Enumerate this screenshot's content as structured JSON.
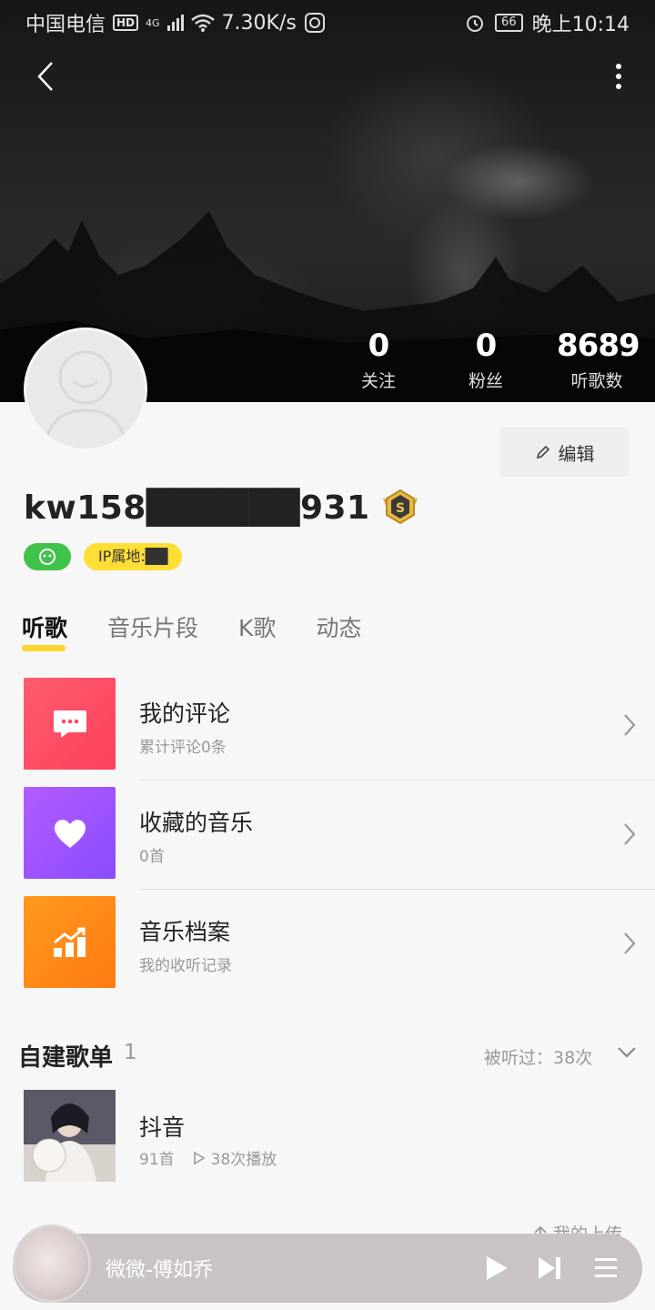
{
  "status_bar": {
    "carrier": "中国电信",
    "hd": "HD",
    "network": "4G",
    "speed": "7.30K/s",
    "battery": "66",
    "time": "晚上10:14"
  },
  "profile": {
    "stats": [
      {
        "value": "0",
        "label": "关注"
      },
      {
        "value": "0",
        "label": "粉丝"
      },
      {
        "value": "8689",
        "label": "听歌数"
      }
    ],
    "edit_label": "编辑",
    "username": "kw158██████931",
    "ip_label": "IP属地:██"
  },
  "tabs": [
    {
      "label": "听歌",
      "active": true
    },
    {
      "label": "音乐片段",
      "active": false
    },
    {
      "label": "K歌",
      "active": false
    },
    {
      "label": "动态",
      "active": false
    }
  ],
  "features": [
    {
      "title": "我的评论",
      "subtitle": "累计评论0条",
      "icon": "comment-icon"
    },
    {
      "title": "收藏的音乐",
      "subtitle": "0首",
      "icon": "heart-icon"
    },
    {
      "title": "音乐档案",
      "subtitle": "我的收听记录",
      "icon": "stats-icon"
    }
  ],
  "playlists": {
    "title": "自建歌单",
    "count": "1",
    "heard": "被听过：38次",
    "items": [
      {
        "name": "抖音",
        "tracks": "91首",
        "plays": "38次播放"
      }
    ]
  },
  "upload_label": "我的上传",
  "player": {
    "song": "微微-傅如乔"
  },
  "colors": {
    "accent_yellow": "#ffd42a",
    "comment_red": "#fe4b63",
    "heart_purple": "#a855ff",
    "stats_orange": "#ff8a18",
    "tag_green": "#3ec24a"
  }
}
